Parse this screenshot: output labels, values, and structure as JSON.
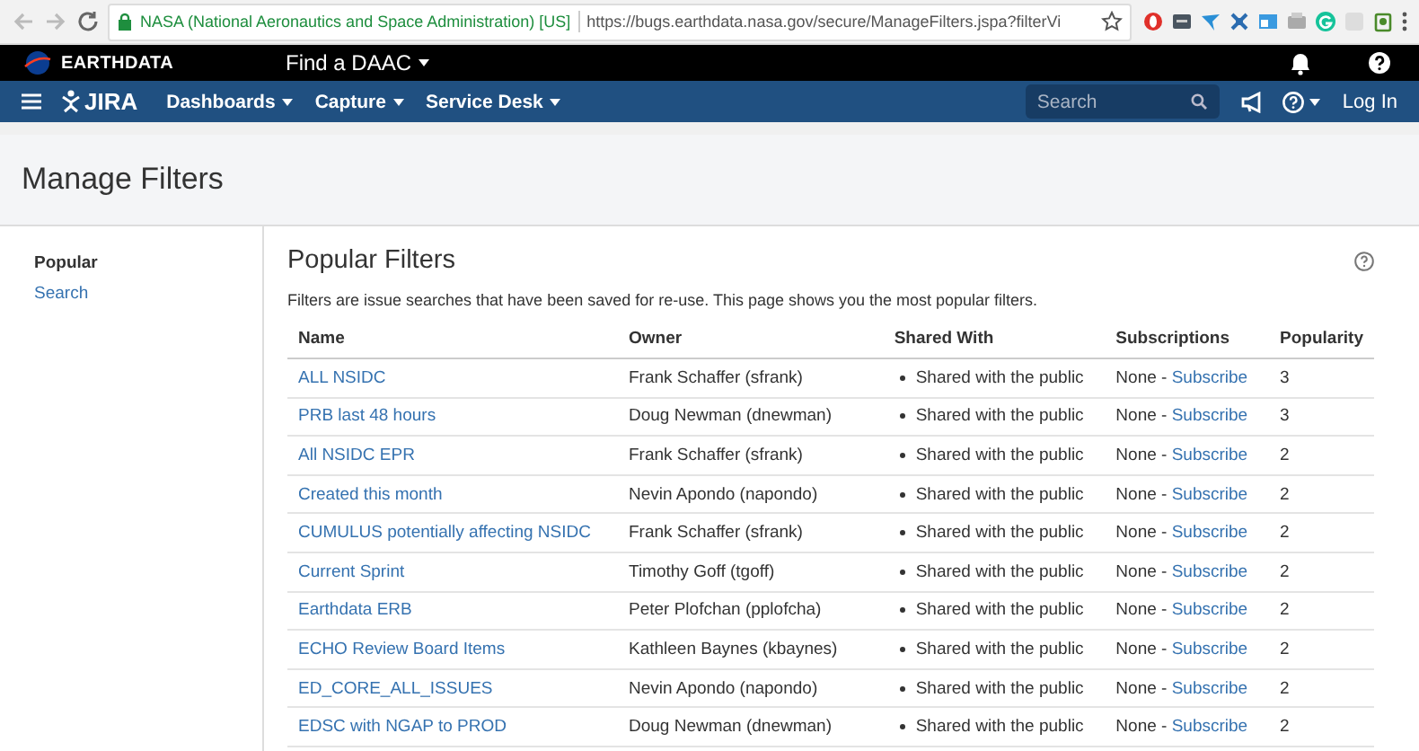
{
  "browser": {
    "site_identity": "NASA (National Aeronautics and Space Administration) [US]",
    "url": "https://bugs.earthdata.nasa.gov/secure/ManageFilters.jspa?filterVi"
  },
  "earthdata_bar": {
    "brand": "EARTHDATA",
    "menu": "Find a DAAC"
  },
  "nav": {
    "logo": "JIRA",
    "menus": [
      "Dashboards",
      "Capture",
      "Service Desk"
    ],
    "search": {
      "placeholder": "Search"
    },
    "login": "Log In"
  },
  "page": {
    "title": "Manage Filters"
  },
  "sidebar": {
    "items": [
      {
        "label": "Popular",
        "selected": true
      },
      {
        "label": "Search",
        "selected": false
      }
    ]
  },
  "content": {
    "title": "Popular Filters",
    "description": "Filters are issue searches that have been saved for re-use. This page shows you the most popular filters.",
    "table": {
      "columns": [
        "Name",
        "Owner",
        "Shared With",
        "Subscriptions",
        "Popularity"
      ],
      "rows": [
        {
          "name": "ALL NSIDC",
          "owner": "Frank Schaffer (sfrank)",
          "shared": "Shared with the public",
          "subscriptions": "None -",
          "subscribe": "Subscribe",
          "popularity": "3"
        },
        {
          "name": "PRB last 48 hours",
          "owner": "Doug Newman (dnewman)",
          "shared": "Shared with the public",
          "subscriptions": "None -",
          "subscribe": "Subscribe",
          "popularity": "3"
        },
        {
          "name": "All NSIDC EPR",
          "owner": "Frank Schaffer (sfrank)",
          "shared": "Shared with the public",
          "subscriptions": "None -",
          "subscribe": "Subscribe",
          "popularity": "2"
        },
        {
          "name": "Created this month",
          "owner": "Nevin Apondo (napondo)",
          "shared": "Shared with the public",
          "subscriptions": "None -",
          "subscribe": "Subscribe",
          "popularity": "2"
        },
        {
          "name": "CUMULUS potentially affecting NSIDC",
          "owner": "Frank Schaffer (sfrank)",
          "shared": "Shared with the public",
          "subscriptions": "None -",
          "subscribe": "Subscribe",
          "popularity": "2"
        },
        {
          "name": "Current Sprint",
          "owner": "Timothy Goff (tgoff)",
          "shared": "Shared with the public",
          "subscriptions": "None -",
          "subscribe": "Subscribe",
          "popularity": "2"
        },
        {
          "name": "Earthdata ERB",
          "owner": "Peter Plofchan (pplofcha)",
          "shared": "Shared with the public",
          "subscriptions": "None -",
          "subscribe": "Subscribe",
          "popularity": "2"
        },
        {
          "name": "ECHO Review Board Items",
          "owner": "Kathleen Baynes (kbaynes)",
          "shared": "Shared with the public",
          "subscriptions": "None -",
          "subscribe": "Subscribe",
          "popularity": "2"
        },
        {
          "name": "ED_CORE_ALL_ISSUES",
          "owner": "Nevin Apondo (napondo)",
          "shared": "Shared with the public",
          "subscriptions": "None -",
          "subscribe": "Subscribe",
          "popularity": "2"
        },
        {
          "name": "EDSC with NGAP to PROD",
          "owner": "Doug Newman (dnewman)",
          "shared": "Shared with the public",
          "subscriptions": "None -",
          "subscribe": "Subscribe",
          "popularity": "2"
        }
      ]
    }
  }
}
